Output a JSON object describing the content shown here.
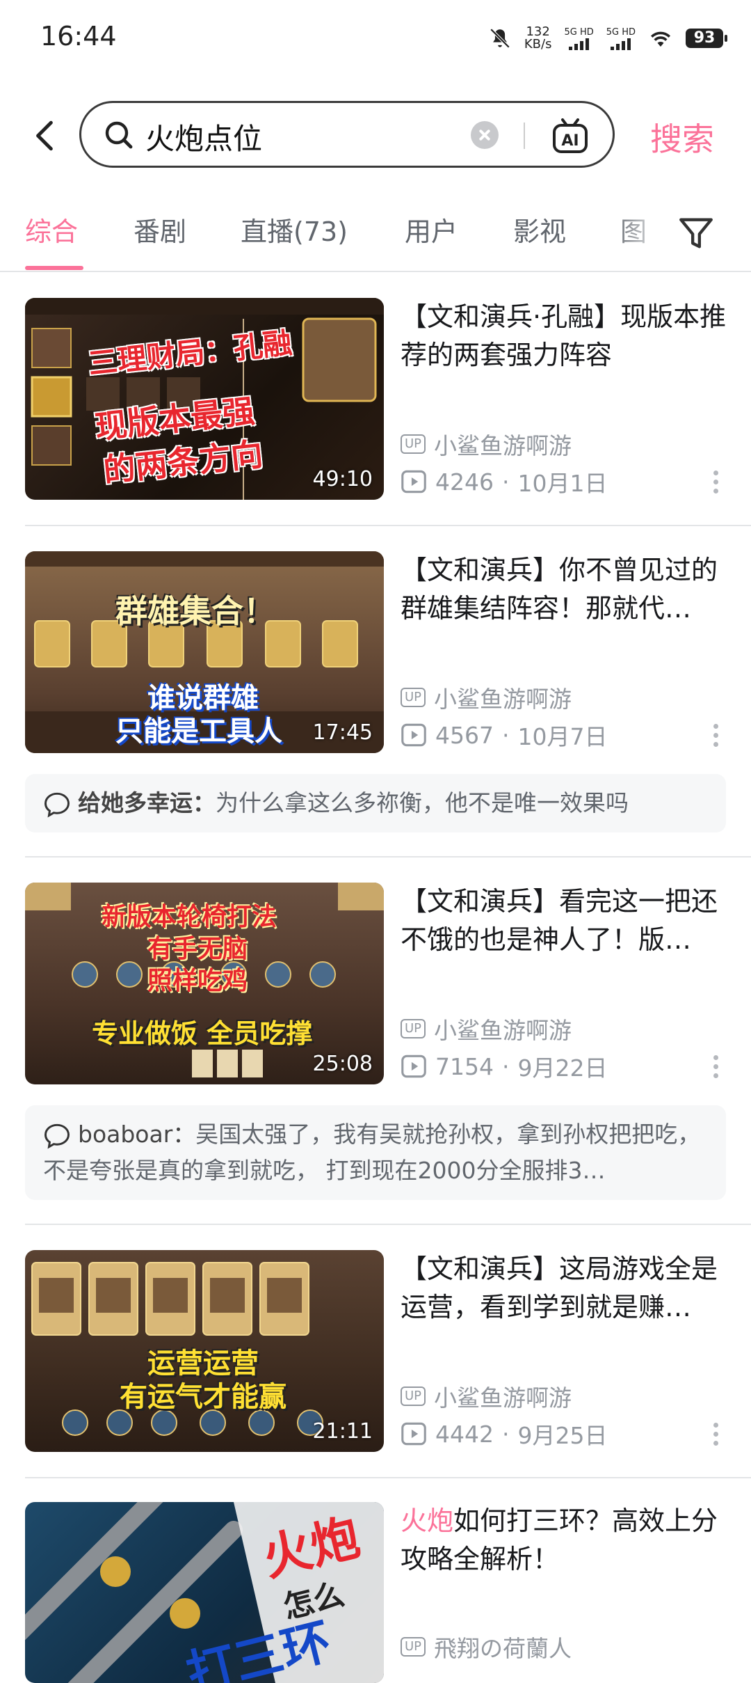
{
  "status_bar": {
    "time": "16:44",
    "net_speed_value": "132",
    "net_speed_unit": "KB/s",
    "sim1": "5G HD",
    "sim2": "5G HD",
    "battery": "93"
  },
  "search": {
    "query": "火炮点位",
    "button_label": "搜索"
  },
  "tabs": [
    "综合",
    "番剧",
    "直播(73)",
    "用户",
    "影视",
    "图"
  ],
  "active_tab": 0,
  "results": [
    {
      "title": "【文和演兵·孔融】现版本推荐的两套强力阵容",
      "duration": "49:10",
      "uploader": "小鲨鱼游啊游",
      "plays": "4246",
      "date": "10月1日",
      "thumb_lines": [
        "三理财局：孔融",
        "现版本最强",
        "的两条方向"
      ]
    },
    {
      "title": "【文和演兵】你不曾见过的群雄集结阵容！那就代…",
      "duration": "17:45",
      "uploader": "小鲨鱼游啊游",
      "plays": "4567",
      "date": "10月7日",
      "thumb_lines": [
        "群雄集合！",
        "谁说群雄",
        "只能是工具人"
      ],
      "comment": {
        "user": "给她多幸运：",
        "text": "为什么拿这么多祢衡，他不是唯一效果吗"
      }
    },
    {
      "title": "【文和演兵】看完这一把还不饿的也是神人了！版…",
      "duration": "25:08",
      "uploader": "小鲨鱼游啊游",
      "plays": "7154",
      "date": "9月22日",
      "thumb_lines": [
        "新版本轮椅打法",
        "有手无脑",
        "照样吃鸡",
        "专业做饭 全员吃撑"
      ],
      "comment": {
        "user": "boaboar：",
        "text": "吴国太强了，我有吴就抢孙权，拿到孙权把把吃，不是夸张是真的拿到就吃， 打到现在2000分全服排3…"
      }
    },
    {
      "title": "【文和演兵】这局游戏全是运营，看到学到就是赚…",
      "duration": "21:11",
      "uploader": "小鲨鱼游啊游",
      "plays": "4442",
      "date": "9月25日",
      "thumb_lines": [
        "运营运营",
        "有运气才能赢"
      ]
    },
    {
      "title_highlight": "火炮",
      "title_rest": "如何打三环？高效上分攻略全解析！",
      "uploader": "飛翔の荷蘭人",
      "thumb_lines": [
        "火炮",
        "怎么",
        "打三环"
      ]
    }
  ],
  "colors": {
    "accent": "#fb7299",
    "text": "#18191c",
    "muted": "#9499a0"
  },
  "icons": [
    "back-arrow-icon",
    "search-icon",
    "clear-icon",
    "ai-icon",
    "filter-icon",
    "up-badge-icon",
    "play-count-icon",
    "more-icon",
    "comment-icon"
  ]
}
